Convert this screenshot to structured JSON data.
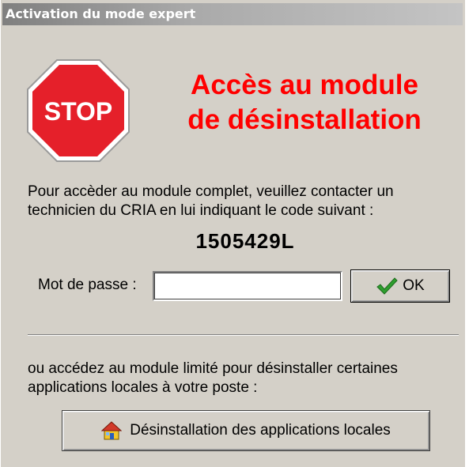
{
  "window": {
    "title": "Activation du mode expert"
  },
  "stop_sign": {
    "text": "STOP",
    "color": "#e5202a"
  },
  "headline": {
    "line1": "Accès au module",
    "line2": "de désinstallation",
    "color": "#ff0000"
  },
  "info": {
    "line1": "Pour accèder au module complet, veuillez contacter un",
    "line2": "technicien du CRIA en lui indiquant le code suivant :"
  },
  "code": "1505429L",
  "password": {
    "label": "Mot de passe :",
    "value": ""
  },
  "ok_button": {
    "label": "OK",
    "icon": "checkmark-icon"
  },
  "limited": {
    "line1": "ou accédez au module limité pour désinstaller certaines",
    "line2": "applications locales à votre poste :"
  },
  "uninstall_button": {
    "label": "Désinstallation des applications locales",
    "icon": "house-icon"
  }
}
